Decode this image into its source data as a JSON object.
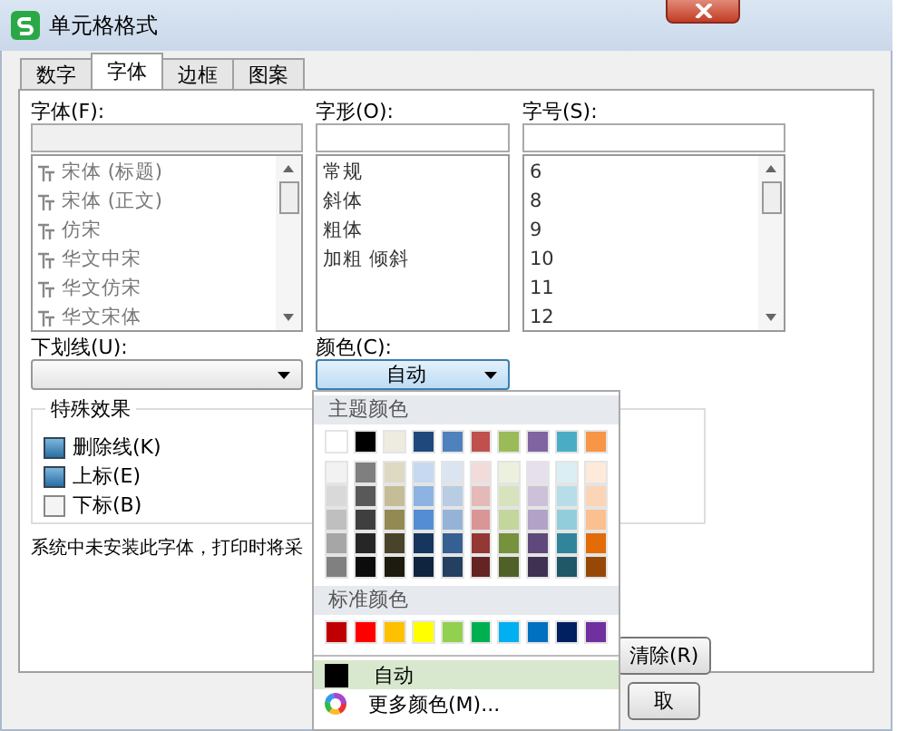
{
  "window": {
    "title": "单元格格式"
  },
  "tabs": [
    {
      "label": "数字",
      "selected": false
    },
    {
      "label": "字体",
      "selected": true
    },
    {
      "label": "边框",
      "selected": false
    },
    {
      "label": "图案",
      "selected": false
    }
  ],
  "font": {
    "label": "字体(F):",
    "items": [
      "宋体 (标题)",
      "宋体 (正文)",
      "仿宋",
      "华文中宋",
      "华文仿宋",
      "华文宋体"
    ]
  },
  "style": {
    "label": "字形(O):",
    "items": [
      "常规",
      "斜体",
      "粗体",
      "加粗 倾斜"
    ]
  },
  "size": {
    "label": "字号(S):",
    "items": [
      "6",
      "8",
      "9",
      "10",
      "11",
      "12"
    ]
  },
  "underline": {
    "label": "下划线(U):"
  },
  "color": {
    "label": "颜色(C):",
    "value": "自动"
  },
  "effects": {
    "title": "特殊效果",
    "options": [
      {
        "label": "删除线(K)",
        "checked": true
      },
      {
        "label": "上标(E)",
        "checked": true
      },
      {
        "label": "下标(B)",
        "checked": false
      }
    ]
  },
  "message": "系统中未安装此字体，打印时将采",
  "buttons": [
    "清除(R)",
    "取"
  ],
  "color_menu": {
    "theme_title": "主题颜色",
    "theme": [
      {
        "color": "#ffffff"
      },
      {
        "color": "#000000"
      },
      {
        "color": "#eeece1"
      },
      {
        "color": "#1f497d"
      },
      {
        "color": "#4f81bd"
      },
      {
        "color": "#c0504d"
      },
      {
        "color": "#9bbb59"
      },
      {
        "color": "#8064a2"
      },
      {
        "color": "#4bacc6"
      },
      {
        "color": "#f79646"
      }
    ],
    "shades": [
      [
        {
          "color": "#f2f2f2"
        },
        {
          "color": "#7f7f7f"
        },
        {
          "color": "#ddd9c3"
        },
        {
          "color": "#c6d9f0"
        },
        {
          "color": "#dbe5f1"
        },
        {
          "color": "#f2dcdb"
        },
        {
          "color": "#ebf1dd"
        },
        {
          "color": "#e5e0ec"
        },
        {
          "color": "#dbeef3"
        },
        {
          "color": "#fdeada"
        }
      ],
      [
        {
          "color": "#d9d9d9"
        },
        {
          "color": "#595959"
        },
        {
          "color": "#c4bd97"
        },
        {
          "color": "#8db3e2"
        },
        {
          "color": "#b8cce4"
        },
        {
          "color": "#e5b9b7"
        },
        {
          "color": "#d7e3bc"
        },
        {
          "color": "#ccc1d9"
        },
        {
          "color": "#b7dde8"
        },
        {
          "color": "#fbd5b5"
        }
      ],
      [
        {
          "color": "#bfbfbf"
        },
        {
          "color": "#3f3f3f"
        },
        {
          "color": "#938953"
        },
        {
          "color": "#548dd4"
        },
        {
          "color": "#95b3d7"
        },
        {
          "color": "#d99694"
        },
        {
          "color": "#c3d69b"
        },
        {
          "color": "#b2a2c7"
        },
        {
          "color": "#92cddc"
        },
        {
          "color": "#fac08f"
        }
      ],
      [
        {
          "color": "#a6a6a6"
        },
        {
          "color": "#262626"
        },
        {
          "color": "#494429"
        },
        {
          "color": "#17365d"
        },
        {
          "color": "#366092"
        },
        {
          "color": "#953734"
        },
        {
          "color": "#76923c"
        },
        {
          "color": "#5f497a"
        },
        {
          "color": "#31859b"
        },
        {
          "color": "#e36c09"
        }
      ],
      [
        {
          "color": "#808080"
        },
        {
          "color": "#0c0c0c"
        },
        {
          "color": "#1d1b10"
        },
        {
          "color": "#0f243e"
        },
        {
          "color": "#244061"
        },
        {
          "color": "#632423"
        },
        {
          "color": "#4f6128"
        },
        {
          "color": "#3f3151"
        },
        {
          "color": "#205867"
        },
        {
          "color": "#974806"
        }
      ]
    ],
    "standard_title": "标准颜色",
    "standard": [
      {
        "color": "#c00000"
      },
      {
        "color": "#ff0000"
      },
      {
        "color": "#ffc000"
      },
      {
        "color": "#ffff00"
      },
      {
        "color": "#92d050"
      },
      {
        "color": "#00b050"
      },
      {
        "color": "#00b0f0"
      },
      {
        "color": "#0070c0"
      },
      {
        "color": "#002060"
      },
      {
        "color": "#7030a0"
      }
    ],
    "auto": {
      "label": "自动",
      "color": "#000000",
      "selected": true
    },
    "more": "更多颜色(M)..."
  }
}
